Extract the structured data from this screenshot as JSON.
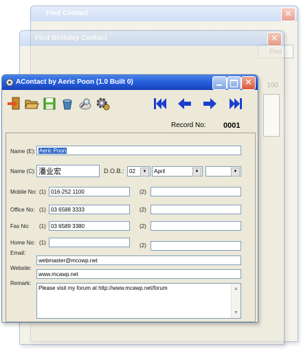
{
  "windows": {
    "back": {
      "title": "Find Contact",
      "button": "Find"
    },
    "middle": {
      "title": "Find Birthday Contact",
      "hint": "100"
    },
    "main": {
      "title": "AContact by Aeric Poon (1.0 Built 0)"
    }
  },
  "toolbar": {
    "icons": [
      "exit-icon",
      "open-folder-icon",
      "save-icon",
      "delete-bucket-icon",
      "search-magnifier-icon",
      "settings-gear-icon"
    ],
    "nav": {
      "first": "first-record-icon",
      "prev": "previous-record-icon",
      "next": "next-record-icon",
      "last": "last-record-icon"
    }
  },
  "record": {
    "label": "Record No:",
    "value": "0001"
  },
  "form": {
    "name_e_label": "Name (E):",
    "name_e": "Aeric Poon",
    "name_c_label": "Name (C):",
    "name_c": "潘业宏",
    "dob_label": "D.O.B.:",
    "dob_day": "02",
    "dob_month": "April",
    "dob_year": "",
    "mobile_label": "Mobile No:",
    "office_label": "Office No:",
    "fax_label": "Fax No:",
    "home_label": "Home No:",
    "slot1": "(1)",
    "slot2": "(2)",
    "mobile1": "016-252 1100",
    "office1": "03 6588 3333",
    "fax1": "03 6589 3380",
    "home1": "",
    "email_label": "Email:",
    "email": "webmaster@mcowp.net",
    "website_label": "Website:",
    "website": "www.mcawp.net",
    "remark_label": "Remark:",
    "remark": "Please visit my forum at http://www.mcawp.net/forum"
  }
}
